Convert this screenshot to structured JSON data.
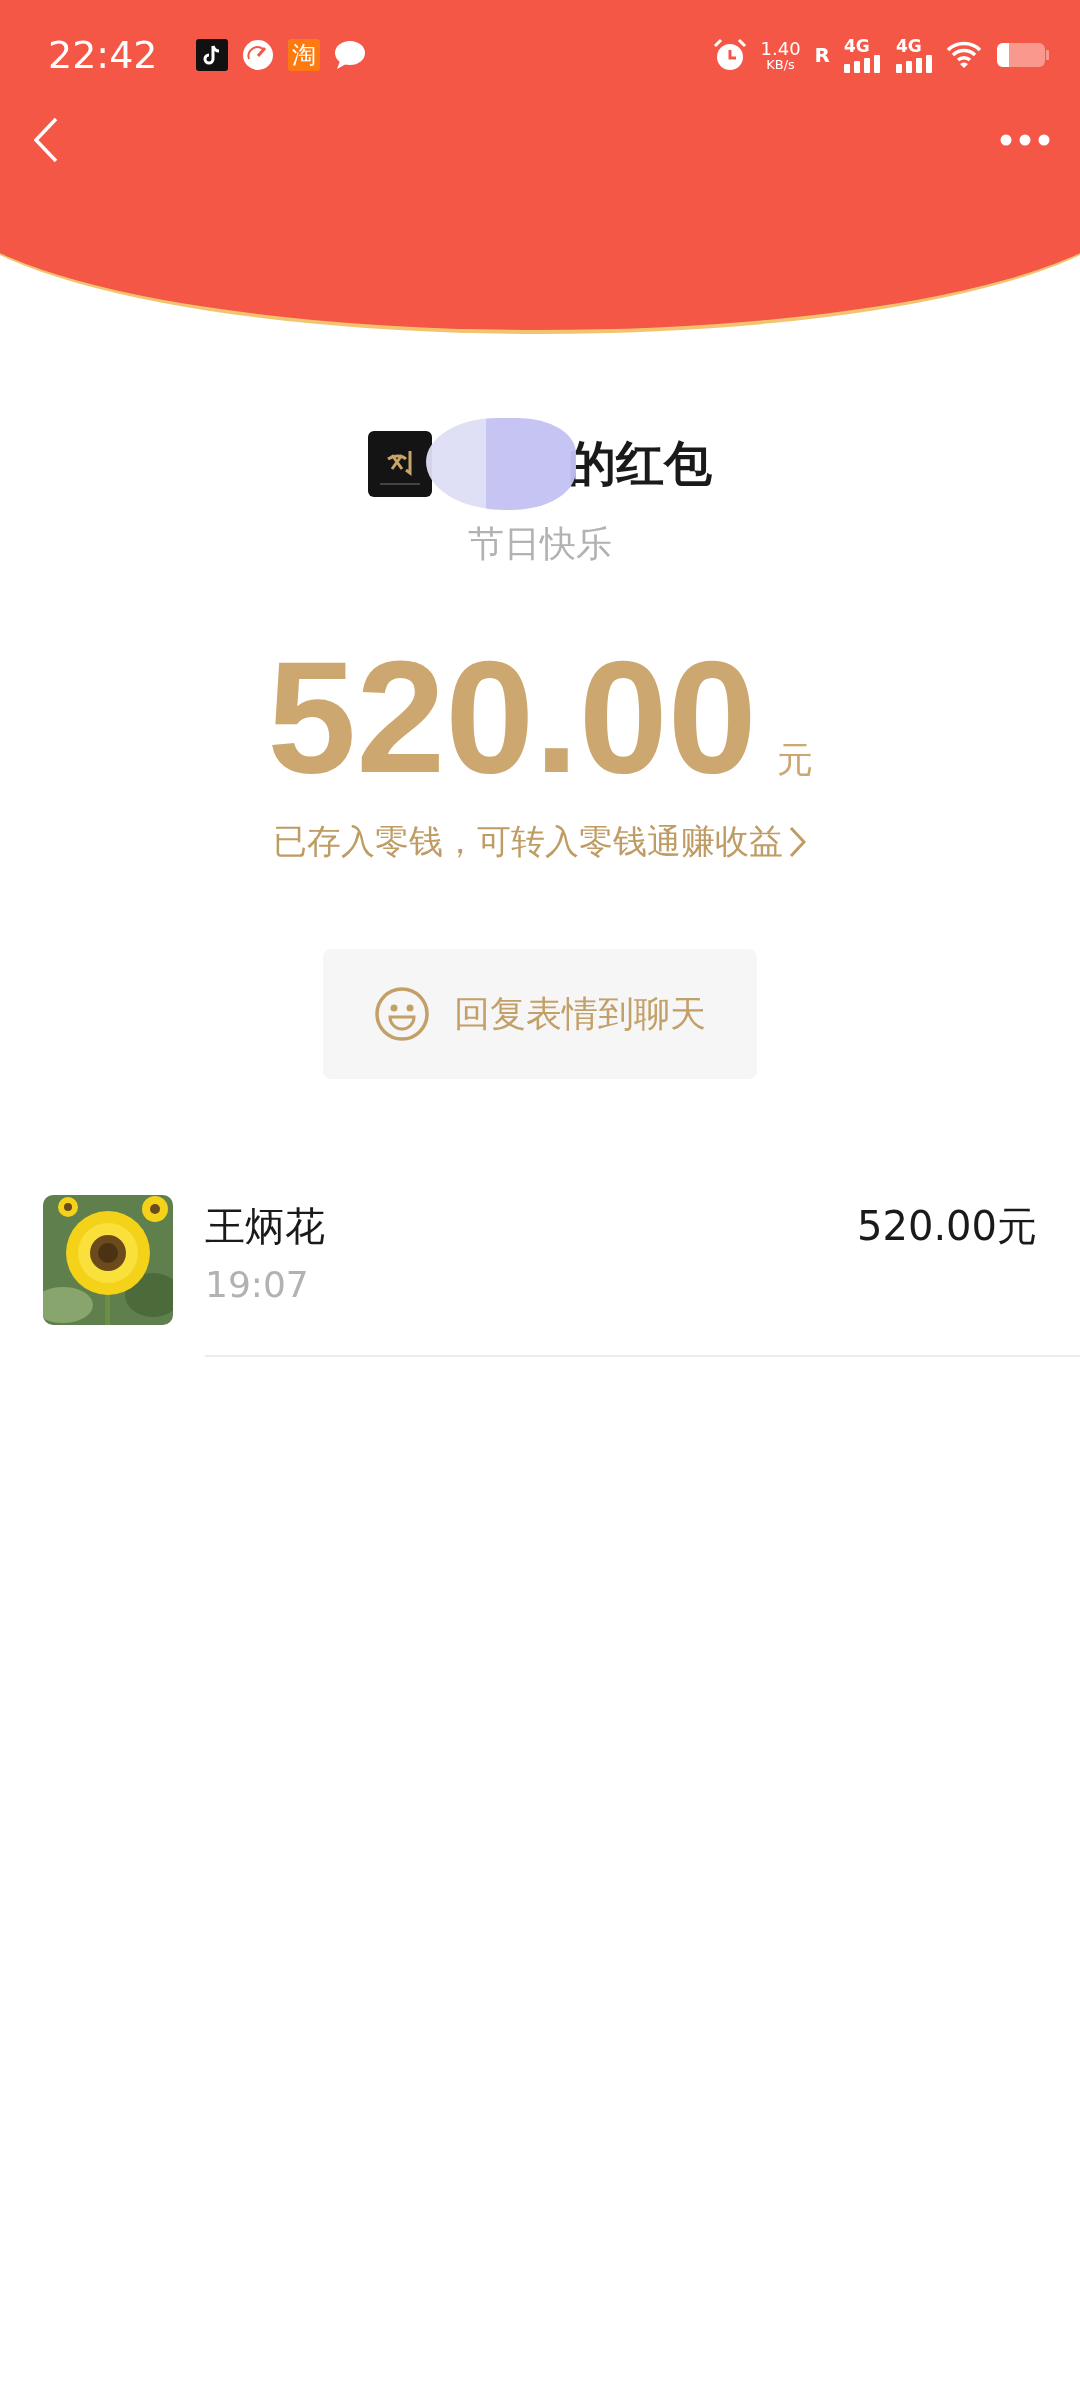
{
  "status_bar": {
    "time": "22:42",
    "notification_icons": [
      {
        "kind": "tiktok"
      },
      {
        "kind": "gauge"
      },
      {
        "kind": "app",
        "text": "淘"
      },
      {
        "kind": "chat"
      }
    ],
    "net_speed": "1.40",
    "net_unit": "KB/s",
    "roaming": "R",
    "signals": [
      {
        "label": "4G"
      },
      {
        "label": "4G"
      }
    ]
  },
  "packet": {
    "title": "的红包",
    "greeting": "节日快乐",
    "amount": "520.00",
    "currency": "元",
    "note": "已存入零钱，可转入零钱通赚收益",
    "reply_button": "回复表情到聊天"
  },
  "records": [
    {
      "name": "王炳花",
      "time": "19:07",
      "amount": "520.00元"
    }
  ]
}
